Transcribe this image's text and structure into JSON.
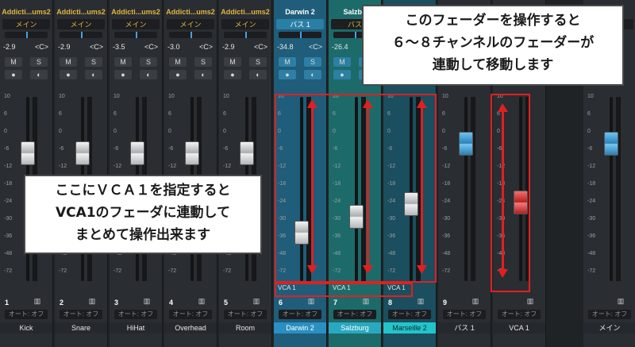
{
  "channels": [
    {
      "num": "1",
      "name": "Addicti...ums2",
      "output": "メイン",
      "vol": "-2.9",
      "pan": "<C>",
      "label": "Kick",
      "auto": "オート: オフ"
    },
    {
      "num": "2",
      "name": "Addicti...ums2",
      "output": "メイン",
      "vol": "-2.9",
      "pan": "<C>",
      "label": "Snare",
      "auto": "オート: オフ"
    },
    {
      "num": "3",
      "name": "Addicti...ums2",
      "output": "メイン",
      "vol": "-3.5",
      "pan": "<C>",
      "label": "HiHat",
      "auto": "オート: オフ"
    },
    {
      "num": "4",
      "name": "Addicti...ums2",
      "output": "メイン",
      "vol": "-3.0",
      "pan": "<C>",
      "label": "Overhead",
      "auto": "オート: オフ"
    },
    {
      "num": "5",
      "name": "Addicti...ums2",
      "output": "メイン",
      "vol": "-2.9",
      "pan": "<C>",
      "label": "Room",
      "auto": "オート: オフ"
    },
    {
      "num": "6",
      "name": "Darwin 2",
      "output": "バス 1",
      "vol": "-34.8",
      "pan": "<C>",
      "label": "Darwin 2",
      "auto": "オート: オフ",
      "vca": "VCA 1"
    },
    {
      "num": "7",
      "name": "Salzbu",
      "output": "バス",
      "vol": "-26.4",
      "pan": "",
      "label": "Salzburg",
      "auto": "オート: オフ",
      "vca": "VCA 1"
    },
    {
      "num": "8",
      "name": "",
      "output": "",
      "vol": "",
      "pan": "",
      "label": "Marseille 2",
      "auto": "オート: オフ",
      "vca": "VCA 1"
    },
    {
      "num": "9",
      "name": "",
      "output": "",
      "vol": "",
      "pan": "",
      "label": "バス 1",
      "auto": "オート: オフ"
    },
    {
      "num": "",
      "name": "",
      "output": "",
      "vol": "",
      "pan": "",
      "label": "VCA 1",
      "auto": "オート: オフ"
    },
    {
      "num": "",
      "name": "",
      "output": "",
      "vol": "",
      "pan": "",
      "label": "メイン",
      "auto": "オート: オフ"
    }
  ],
  "buttons": {
    "mute": "M",
    "solo": "S"
  },
  "scale": [
    "10",
    "6",
    "0",
    "-6",
    "-12",
    "-18",
    "-24",
    "-30",
    "-36",
    "-48",
    "-72"
  ],
  "callouts": {
    "top": [
      "このフェーダーを操作すると",
      "６〜８チャンネルのフェーダーが",
      "連動して移動します"
    ],
    "left": [
      "ここにＶＣＡ１を指定すると",
      "VCA1のフェーダに連動して",
      "まとめて操作出来ます"
    ]
  },
  "colors": {
    "accent": "#e0b540",
    "highlight": "#e02020",
    "selected": "#2a8fc1"
  }
}
